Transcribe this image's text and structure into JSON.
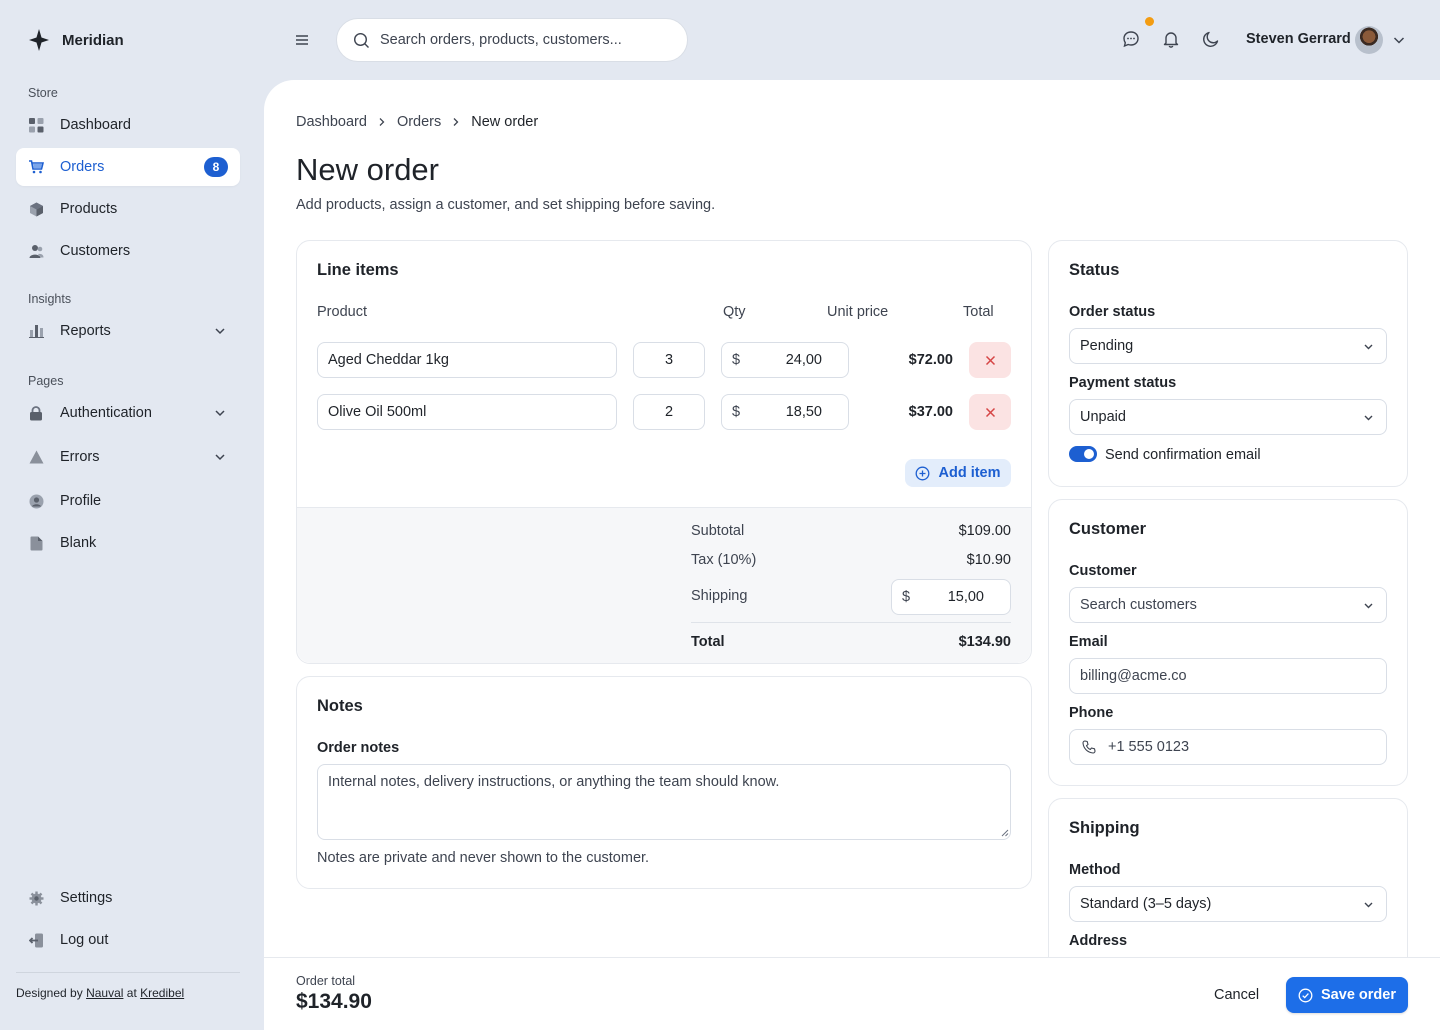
{
  "brand": {
    "name": "Meridian"
  },
  "sidebar": {
    "sections": [
      {
        "title": "Store"
      },
      {
        "title": "Insights"
      },
      {
        "title": "Pages"
      }
    ],
    "items": [
      {
        "label": "Dashboard",
        "icon": "dashboard-icon"
      },
      {
        "label": "Orders",
        "icon": "cart-icon",
        "badge": "8",
        "active": true
      },
      {
        "label": "Products",
        "icon": "box-icon"
      },
      {
        "label": "Customers",
        "icon": "users-icon"
      },
      {
        "label": "Reports",
        "icon": "bar-chart-icon"
      },
      {
        "label": "Authentication",
        "icon": "lock-icon"
      },
      {
        "label": "Errors",
        "icon": "warning-icon"
      },
      {
        "label": "Profile",
        "icon": "user-circle-icon"
      },
      {
        "label": "Blank",
        "icon": "file-icon"
      },
      {
        "label": "Settings",
        "icon": "gear-icon"
      },
      {
        "label": "Log out",
        "icon": "logout-icon"
      }
    ],
    "credit": {
      "prefix": "Designed by",
      "author": "Nauval",
      "mid": "at",
      "company": "Kredibel"
    }
  },
  "topbar": {
    "search_placeholder": "Search orders, products, customers...",
    "user_name": "Steven Gerrard"
  },
  "breadcrumb": [
    "Dashboard",
    "Orders",
    "New order"
  ],
  "page": {
    "title": "New order",
    "subtitle": "Add products, assign a customer, and set shipping before saving."
  },
  "line_items": {
    "title": "Line items",
    "headers": {
      "product": "Product",
      "qty": "Qty",
      "unit_price": "Unit price",
      "total": "Total"
    },
    "rows": [
      {
        "product": "Aged Cheddar 1kg",
        "qty": "3",
        "currency": "$",
        "unit_price": "24,00",
        "total": "$72.00"
      },
      {
        "product": "Olive Oil 500ml",
        "qty": "2",
        "currency": "$",
        "unit_price": "18,50",
        "total": "$37.00"
      }
    ],
    "add_label": "Add item",
    "summary": {
      "subtotal_label": "Subtotal",
      "subtotal": "$109.00",
      "tax_label": "Tax (10%)",
      "tax": "$10.90",
      "shipping_label": "Shipping",
      "shipping_currency": "$",
      "shipping": "15,00",
      "total_label": "Total",
      "total": "$134.90"
    }
  },
  "notes": {
    "title": "Notes",
    "label": "Order notes",
    "placeholder": "Internal notes, delivery instructions, or anything the team should know.",
    "help": "Notes are private and never shown to the customer."
  },
  "status": {
    "title": "Status",
    "order_status_label": "Order status",
    "order_status": "Pending",
    "payment_status_label": "Payment status",
    "payment_status": "Unpaid",
    "confirmation_label": "Send confirmation email",
    "confirmation_on": true
  },
  "customer": {
    "title": "Customer",
    "customer_label": "Customer",
    "customer_placeholder": "Search customers",
    "email_label": "Email",
    "email": "billing@acme.co",
    "phone_label": "Phone",
    "phone_placeholder": "+1 555 0123"
  },
  "shipping": {
    "title": "Shipping",
    "method_label": "Method",
    "method": "Standard (3–5 days)",
    "address_label": "Address"
  },
  "footer": {
    "total_label": "Order total",
    "total": "$134.90",
    "cancel_label": "Cancel",
    "save_label": "Save order"
  },
  "colors": {
    "accent": "#1d5fd1",
    "danger_bg": "#fbe3e3",
    "page_bg": "#e3e8f1"
  }
}
